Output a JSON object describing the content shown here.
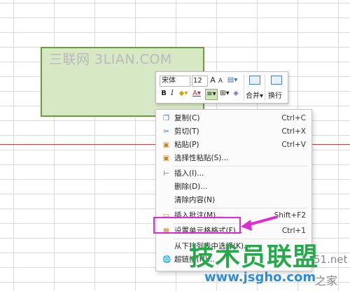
{
  "watermark_top": "三联网 3LIAN.COM",
  "toolbar": {
    "font": "宋体",
    "size": "12",
    "font_grow": "A",
    "font_shrink": "A",
    "bold": "B",
    "italic": "I",
    "merge_label": "合并",
    "wrap_label": "换行"
  },
  "menu": {
    "items": [
      {
        "label": "复制(C)",
        "shortcut": "Ctrl+C"
      },
      {
        "label": "剪切(T)",
        "shortcut": "Ctrl+X"
      },
      {
        "label": "粘贴(P)",
        "shortcut": "Ctrl+V"
      },
      {
        "label": "选择性粘贴(S)...",
        "shortcut": ""
      },
      {
        "label": "插入(I)...",
        "shortcut": ""
      },
      {
        "label": "删除(D)...",
        "shortcut": ""
      },
      {
        "label": "清除内容(N)",
        "shortcut": ""
      },
      {
        "label": "插入批注(M)...",
        "shortcut": "Shift+F2"
      },
      {
        "label": "设置单元格格式(F)...",
        "shortcut": "Ctrl+1"
      },
      {
        "label": "从下拉列表中选择(K)...",
        "shortcut": ""
      },
      {
        "label": "超链接(H)...",
        "shortcut": ""
      }
    ]
  },
  "logo": {
    "main": "技术员联盟",
    "url": "www.jsgho.com",
    "side_top": "51.net",
    "side_bottom": "之家"
  },
  "colors": {
    "selection_fill": "#d7e8c4",
    "selection_border": "#6a9c3e",
    "highlight": "#e02ad3",
    "logo_green": "#27a84a",
    "logo_blue": "#2d8bd8"
  }
}
